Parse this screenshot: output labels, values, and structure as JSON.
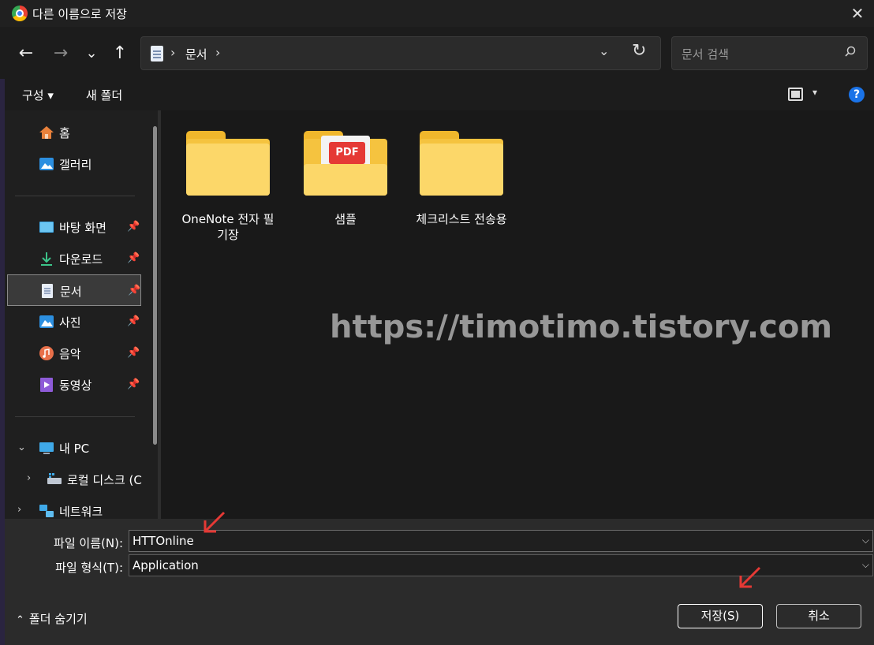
{
  "window": {
    "title": "다른 이름으로 저장",
    "close": "✕"
  },
  "nav": {
    "back": "←",
    "forward": "→",
    "recent": "⌄",
    "up": "↑",
    "breadcrumb_sep": "›",
    "crumb": "문서",
    "address_dropdown": "⌄",
    "refresh": "↻"
  },
  "search": {
    "placeholder": "문서 검색"
  },
  "commands": {
    "organize": "구성 ▾",
    "new_folder": "새 폴더",
    "view_dropdown": "▾",
    "help": "?"
  },
  "sidebar": {
    "home": "홈",
    "gallery": "갤러리",
    "quick": [
      {
        "label": "바탕 화면",
        "icon": "desktop-icon"
      },
      {
        "label": "다운로드",
        "icon": "download-icon"
      },
      {
        "label": "문서",
        "icon": "document-icon"
      },
      {
        "label": "사진",
        "icon": "pictures-icon"
      },
      {
        "label": "음악",
        "icon": "music-icon"
      },
      {
        "label": "동영상",
        "icon": "video-icon"
      }
    ],
    "this_pc": "내 PC",
    "local_disk": "로컬 디스크 (C",
    "network": "네트워크"
  },
  "folders": [
    {
      "name": "OneNote 전자 필기장",
      "type": "plain"
    },
    {
      "name": "샘플",
      "type": "pdf",
      "badge": "PDF"
    },
    {
      "name": "체크리스트 전송용",
      "type": "plain"
    }
  ],
  "watermark": "https://timotimo.tistory.com",
  "form": {
    "filename_label": "파일 이름(N):",
    "filename_value": "HTTOnline",
    "filetype_label": "파일 형식(T):",
    "filetype_value": "Application",
    "dropdown": "⌵"
  },
  "footer": {
    "hide_folders": "폴더 숨기기",
    "save": "저장(S)",
    "cancel": "취소"
  },
  "colors": {
    "accent": "#1a73e8",
    "annotation_arrow": "#e53935",
    "folder": "#fcd769"
  }
}
